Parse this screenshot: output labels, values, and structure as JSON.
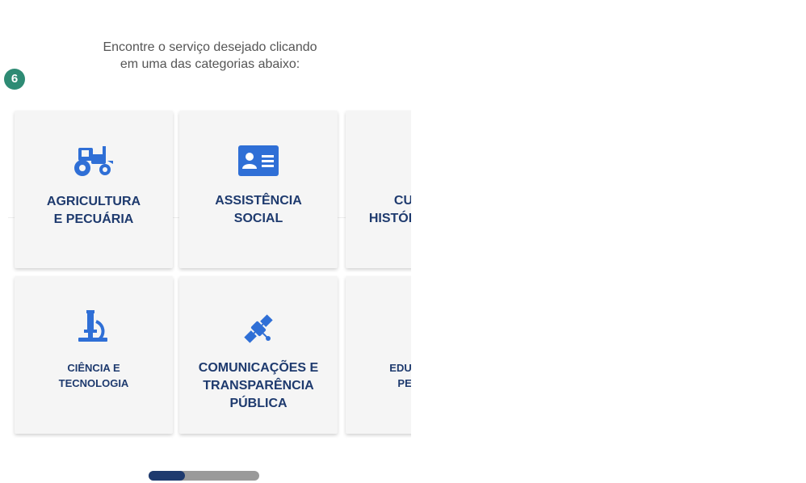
{
  "intro": {
    "line1": "Encontre o serviço desejado clicando",
    "line2": "em uma das categorias abaixo:"
  },
  "step_badge": "6",
  "categories": [
    {
      "icon": "tractor-icon",
      "line1": "AGRICULTURA",
      "line2": "E PECUÁRIA"
    },
    {
      "icon": "id-card-icon",
      "line1": "ASSISTÊNCIA",
      "line2": "SOCIAL"
    },
    {
      "icon": "mask-icon",
      "line1": "CULTURA",
      "line2": "HISTÓRIA E ARTE"
    },
    {
      "icon": "microscope-icon",
      "line1": "CIÊNCIA E",
      "line2": "TECNOLOGIA"
    },
    {
      "icon": "satellite-icon",
      "line1": "COMUNICAÇÕES E",
      "line2": "TRANSPARÊNCIA",
      "line3": "PÚBLICA"
    },
    {
      "icon": "book-icon",
      "line1": "EDUCAÇÃO E",
      "line2": "PESQUISA"
    }
  ],
  "pager": {
    "current": 1,
    "total": 3
  },
  "colors": {
    "accent": "#1e3a6e",
    "icon": "#2f6fd6",
    "badge": "#2e8b74",
    "card": "#f5f5f5"
  }
}
